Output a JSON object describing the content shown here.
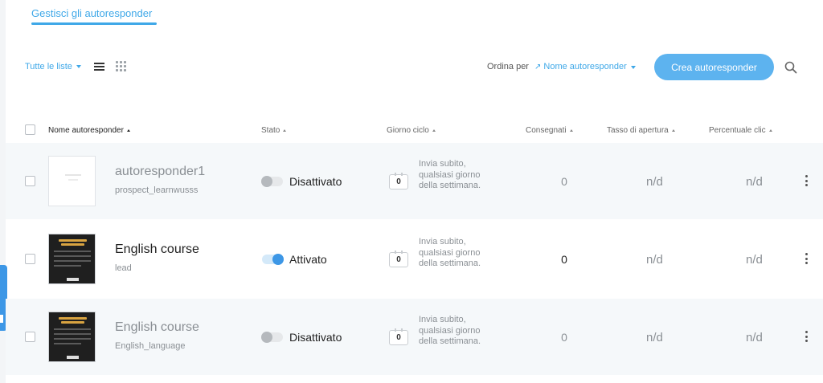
{
  "page": {
    "tab_label": "Gestisci gli autoresponder"
  },
  "toolbar": {
    "list_filter": "Tutte le liste",
    "sort_label": "Ordina per",
    "sort_value": "Nome autoresponder",
    "create_button": "Crea autoresponder",
    "icons": {
      "list_view": "list-view-icon",
      "grid_view": "grid-view-icon",
      "search": "search-icon"
    }
  },
  "table": {
    "columns": [
      "Nome autoresponder",
      "Stato",
      "Giorno ciclo",
      "Consegnati",
      "Tasso di apertura",
      "Percentuale clic"
    ],
    "rows": [
      {
        "name": "autoresponder1",
        "list": "prospect_learnwusss",
        "status": "Disattivato",
        "active": false,
        "day": "0",
        "cycle_desc": "Invia subito, qualsiasi giorno della settimana.",
        "delivered": "0",
        "open_rate": "n/d",
        "click_rate": "n/d"
      },
      {
        "name": "English course",
        "list": "lead",
        "status": "Attivato",
        "active": true,
        "day": "0",
        "cycle_desc": "Invia subito, qualsiasi giorno della settimana.",
        "delivered": "0",
        "open_rate": "n/d",
        "click_rate": "n/d"
      },
      {
        "name": "English course",
        "list": "English_language",
        "status": "Disattivato",
        "active": false,
        "day": "0",
        "cycle_desc": "Invia subito, qualsiasi giorno della settimana.",
        "delivered": "0",
        "open_rate": "n/d",
        "click_rate": "n/d"
      }
    ]
  },
  "colors": {
    "accent": "#3fa8e8",
    "button": "#5db3ef",
    "toggle_on": "#3d97e6",
    "row_alt": "#f5f8fa"
  }
}
